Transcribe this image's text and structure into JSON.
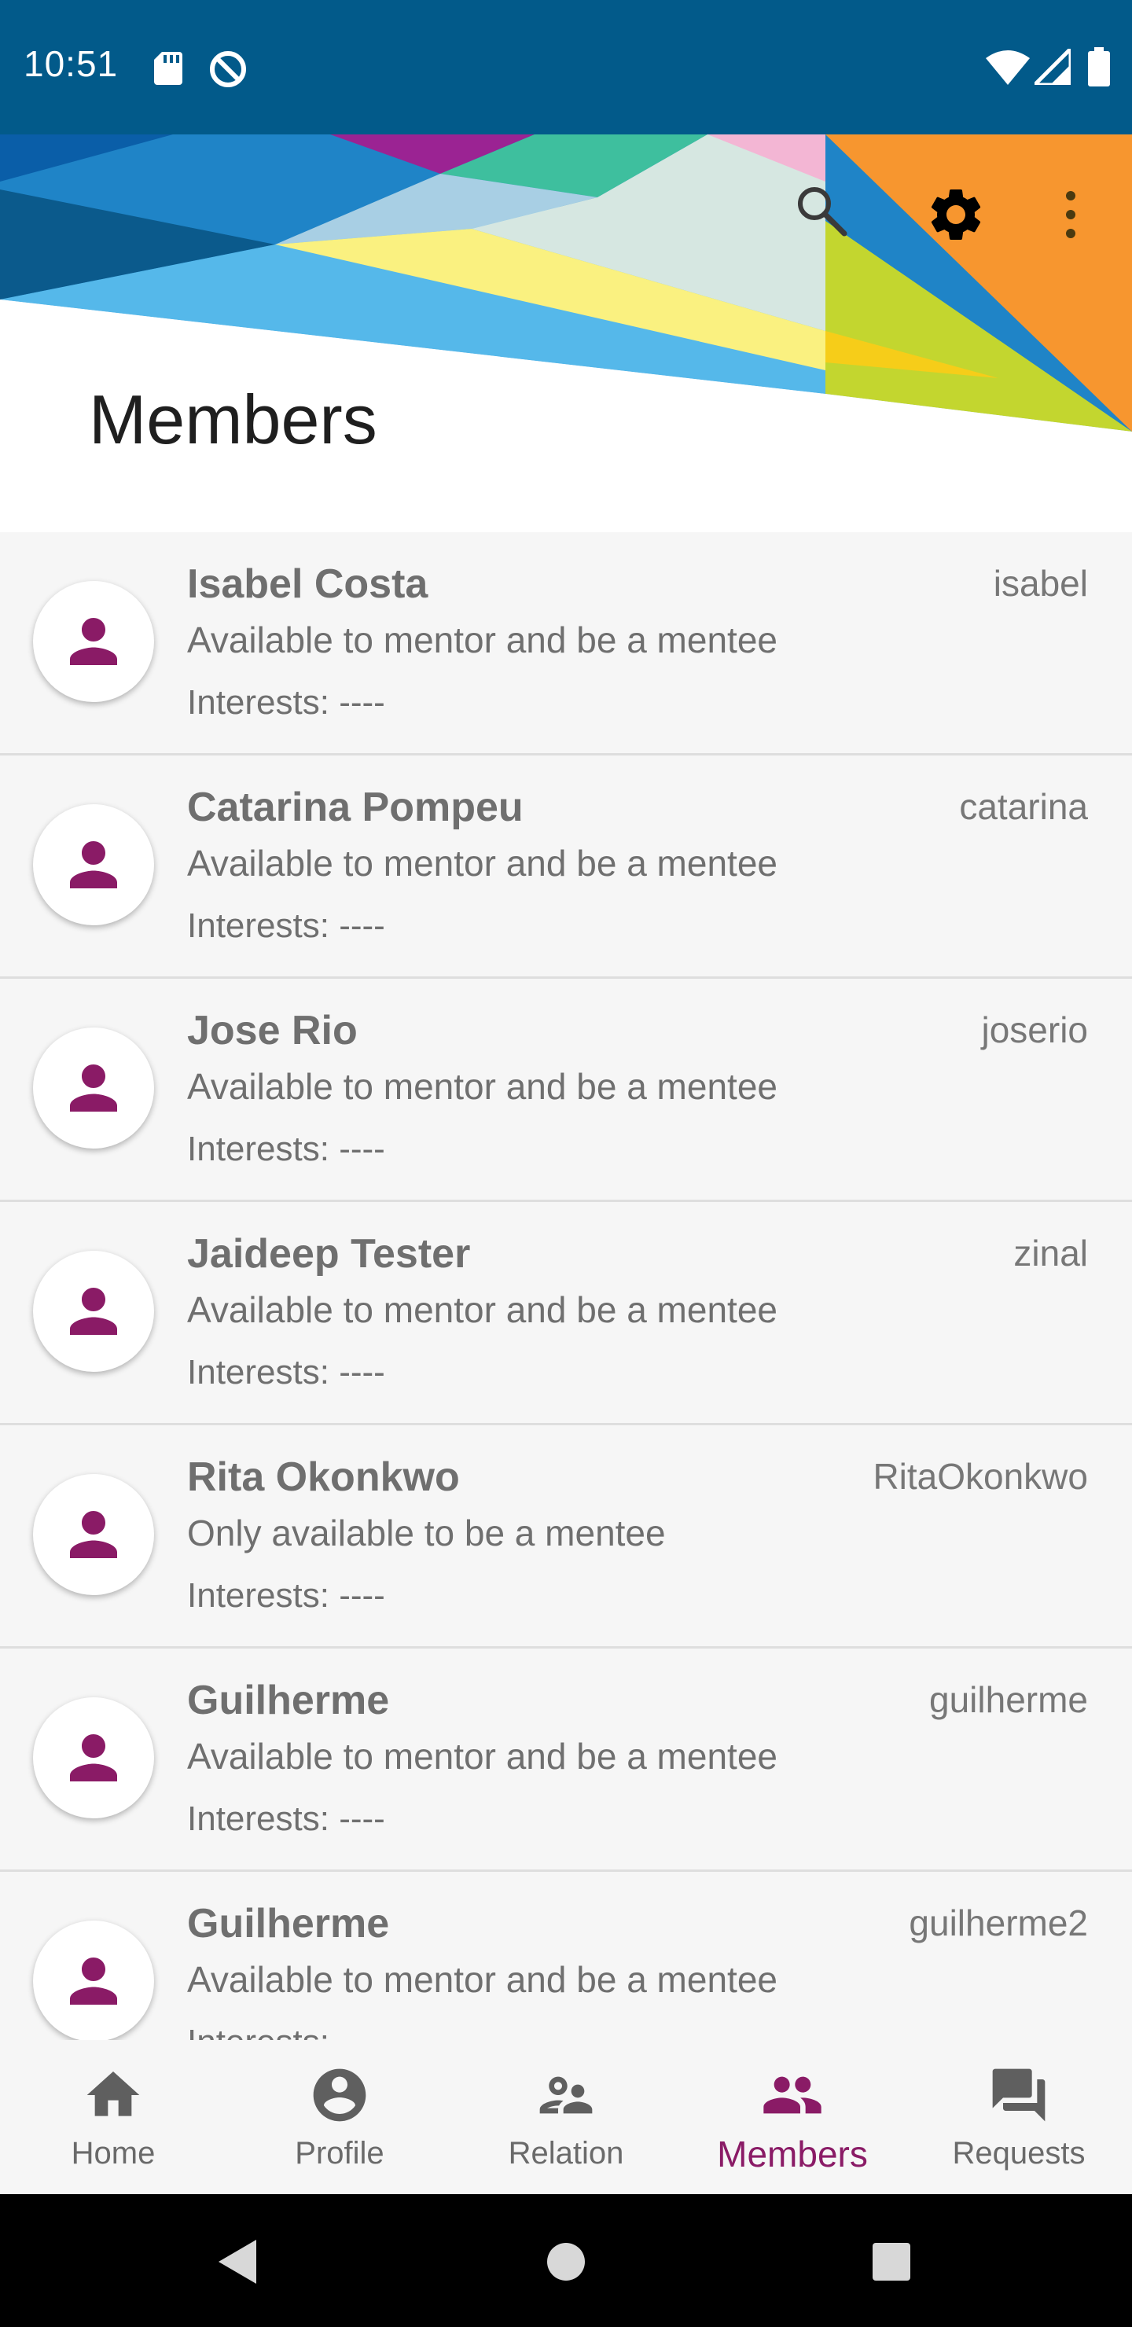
{
  "status_bar": {
    "time": "10:51"
  },
  "header": {
    "title": "Members"
  },
  "members": [
    {
      "name": "Isabel Costa",
      "username": "isabel",
      "availability": "Available to mentor and be a mentee",
      "interests": "Interests: ----"
    },
    {
      "name": "Catarina Pompeu",
      "username": "catarina",
      "availability": "Available to mentor and be a mentee",
      "interests": "Interests: ----"
    },
    {
      "name": "Jose Rio",
      "username": "joserio",
      "availability": "Available to mentor and be a mentee",
      "interests": "Interests: ----"
    },
    {
      "name": "Jaideep Tester",
      "username": "zinal",
      "availability": "Available to mentor and be a mentee",
      "interests": "Interests: ----"
    },
    {
      "name": "Rita Okonkwo",
      "username": "RitaOkonkwo",
      "availability": "Only available to be a mentee",
      "interests": "Interests: ----"
    },
    {
      "name": "Guilherme",
      "username": "guilherme",
      "availability": "Available to mentor and be a mentee",
      "interests": "Interests: ----"
    },
    {
      "name": "Guilherme",
      "username": "guilherme2",
      "availability": "Available to mentor and be a mentee",
      "interests": "Interests: ----"
    }
  ],
  "bottom_nav": {
    "items": [
      {
        "label": "Home",
        "icon": "home-icon"
      },
      {
        "label": "Profile",
        "icon": "account-circle-icon"
      },
      {
        "label": "Relation",
        "icon": "relation-icon"
      },
      {
        "label": "Members",
        "icon": "people-icon"
      },
      {
        "label": "Requests",
        "icon": "forum-icon"
      }
    ],
    "active": "Members"
  },
  "colors": {
    "status_bar": "#025a8a",
    "accent": "#8a1b66",
    "inactive_nav": "#6a6a6a"
  }
}
